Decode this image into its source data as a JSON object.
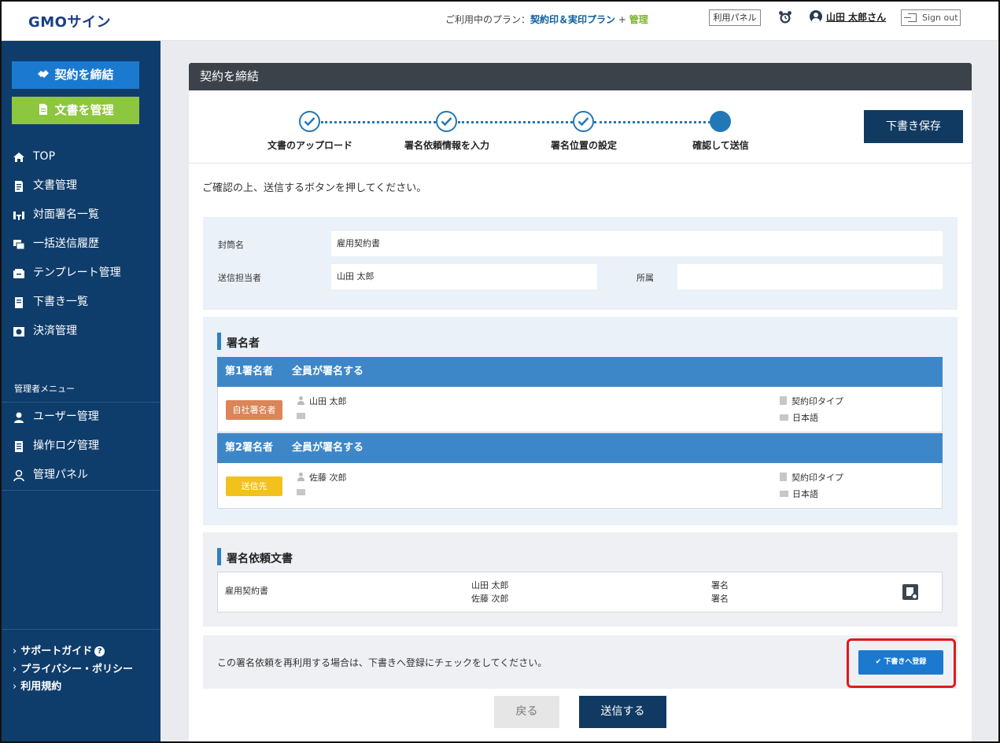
{
  "header": {
    "logo": "GMOサイン",
    "plan_prefix": "ご利用中のプラン：",
    "plan_name": "契約印＆実印プラン",
    "plan_plus": "+",
    "plan_admin": "管理",
    "panel_button": "利用パネル",
    "user_name": "山田 太郎さん",
    "sign_out": "Sign out"
  },
  "sidebar": {
    "contract_button": "契約を締結",
    "docs_button": "文書を管理",
    "items": [
      {
        "label": "TOP",
        "icon": "home-icon"
      },
      {
        "label": "文書管理",
        "icon": "document-icon"
      },
      {
        "label": "対面署名一覧",
        "icon": "face-to-face-icon"
      },
      {
        "label": "一括送信履歴",
        "icon": "bulk-send-icon"
      },
      {
        "label": "テンプレート管理",
        "icon": "template-icon"
      },
      {
        "label": "下書き一覧",
        "icon": "draft-icon"
      },
      {
        "label": "決済管理",
        "icon": "payment-icon"
      }
    ],
    "admin_section": "管理者メニュー",
    "admin_items": [
      {
        "label": "ユーザー管理",
        "icon": "user-icon"
      },
      {
        "label": "操作ログ管理",
        "icon": "log-icon"
      },
      {
        "label": "管理パネル",
        "icon": "admin-panel-icon"
      }
    ],
    "footer": {
      "support": "サポートガイド",
      "privacy": "プライバシー・ポリシー",
      "terms": "利用規約"
    }
  },
  "main": {
    "title": "契約を締結",
    "steps": [
      {
        "label": "文書のアップロード",
        "state": "done"
      },
      {
        "label": "署名依頼情報を入力",
        "state": "done"
      },
      {
        "label": "署名位置の設定",
        "state": "done"
      },
      {
        "label": "確認して送信",
        "state": "current"
      }
    ],
    "draft_save": "下書き保存",
    "instruction": "ご確認の上、送信するボタンを押してください。",
    "envelope": {
      "name_label": "封筒名",
      "name_value": "雇用契約書",
      "sender_label": "送信担当者",
      "sender_value": "山田 太郎",
      "affiliation_label": "所属",
      "affiliation_value": ""
    },
    "signers_title": "署名者",
    "signers": [
      {
        "order": "第1署名者",
        "mode": "全員が署名する",
        "badge": "自社署名者",
        "name": "山田 太郎",
        "type": "契約印タイプ",
        "language": "日本語"
      },
      {
        "order": "第2署名者",
        "mode": "全員が署名する",
        "badge": "送信先",
        "name": "佐藤 次郎",
        "type": "契約印タイプ",
        "language": "日本語"
      }
    ],
    "documents_title": "署名依頼文書",
    "document": {
      "name": "雇用契約書",
      "signer1": "山田 太郎",
      "signer2": "佐藤 次郎",
      "action1": "署名",
      "action2": "署名"
    },
    "reuse_text": "この署名依頼を再利用する場合は、下書きへ登録にチェックをしてください。",
    "register_draft": "✔ 下書きへ登録",
    "back": "戻る",
    "send": "送信する"
  },
  "colors": {
    "sidebar": "#0f3d6b",
    "primary": "#1b7ad0",
    "green": "#8dc63f",
    "navy_button": "#103a62",
    "highlight": "#e11a1a"
  }
}
